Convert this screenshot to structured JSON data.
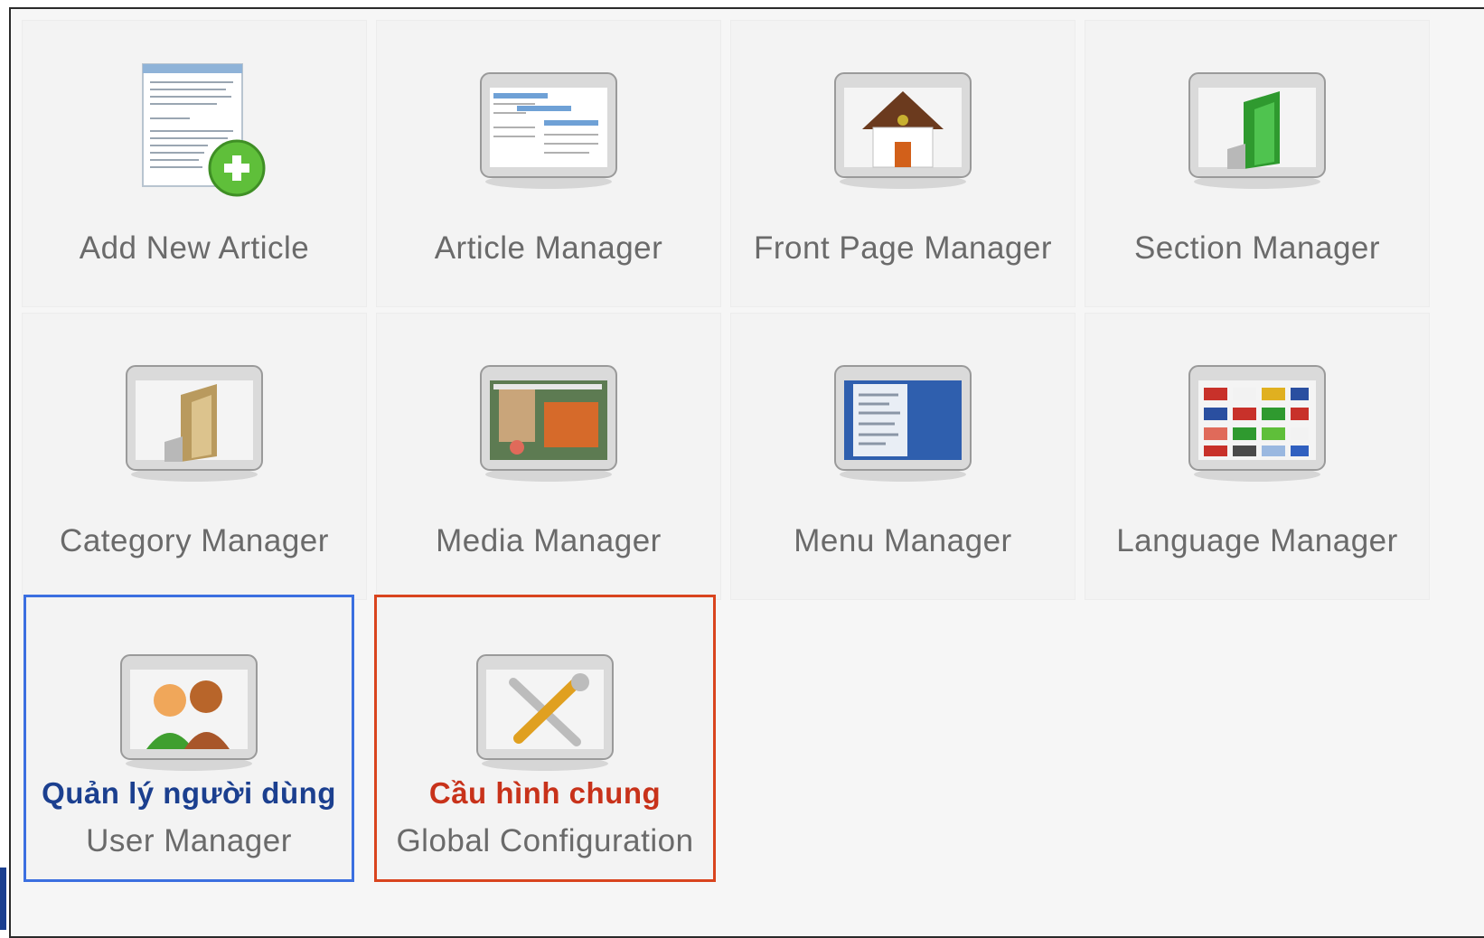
{
  "tiles": [
    {
      "name": "add-new-article",
      "label": "Add New Article",
      "icon": "add-article-icon"
    },
    {
      "name": "article-manager",
      "label": "Article Manager",
      "icon": "article-manager-icon"
    },
    {
      "name": "front-page-manager",
      "label": "Front Page Manager",
      "icon": "house-icon"
    },
    {
      "name": "section-manager",
      "label": "Section Manager",
      "icon": "green-folder-icon"
    },
    {
      "name": "category-manager",
      "label": "Category Manager",
      "icon": "tan-folder-icon"
    },
    {
      "name": "media-manager",
      "label": "Media Manager",
      "icon": "media-icon"
    },
    {
      "name": "menu-manager",
      "label": "Menu Manager",
      "icon": "menu-icon"
    },
    {
      "name": "language-manager",
      "label": "Language Manager",
      "icon": "flags-icon"
    },
    {
      "name": "user-manager",
      "label": "User Manager",
      "vn_label": "Quản lý người dùng",
      "icon": "users-icon",
      "highlight_color": "#3b6fe0"
    },
    {
      "name": "global-configuration",
      "label": "Global Configuration",
      "vn_label": "Cầu hình chung",
      "icon": "tools-icon",
      "highlight_color": "#d9441e"
    }
  ]
}
